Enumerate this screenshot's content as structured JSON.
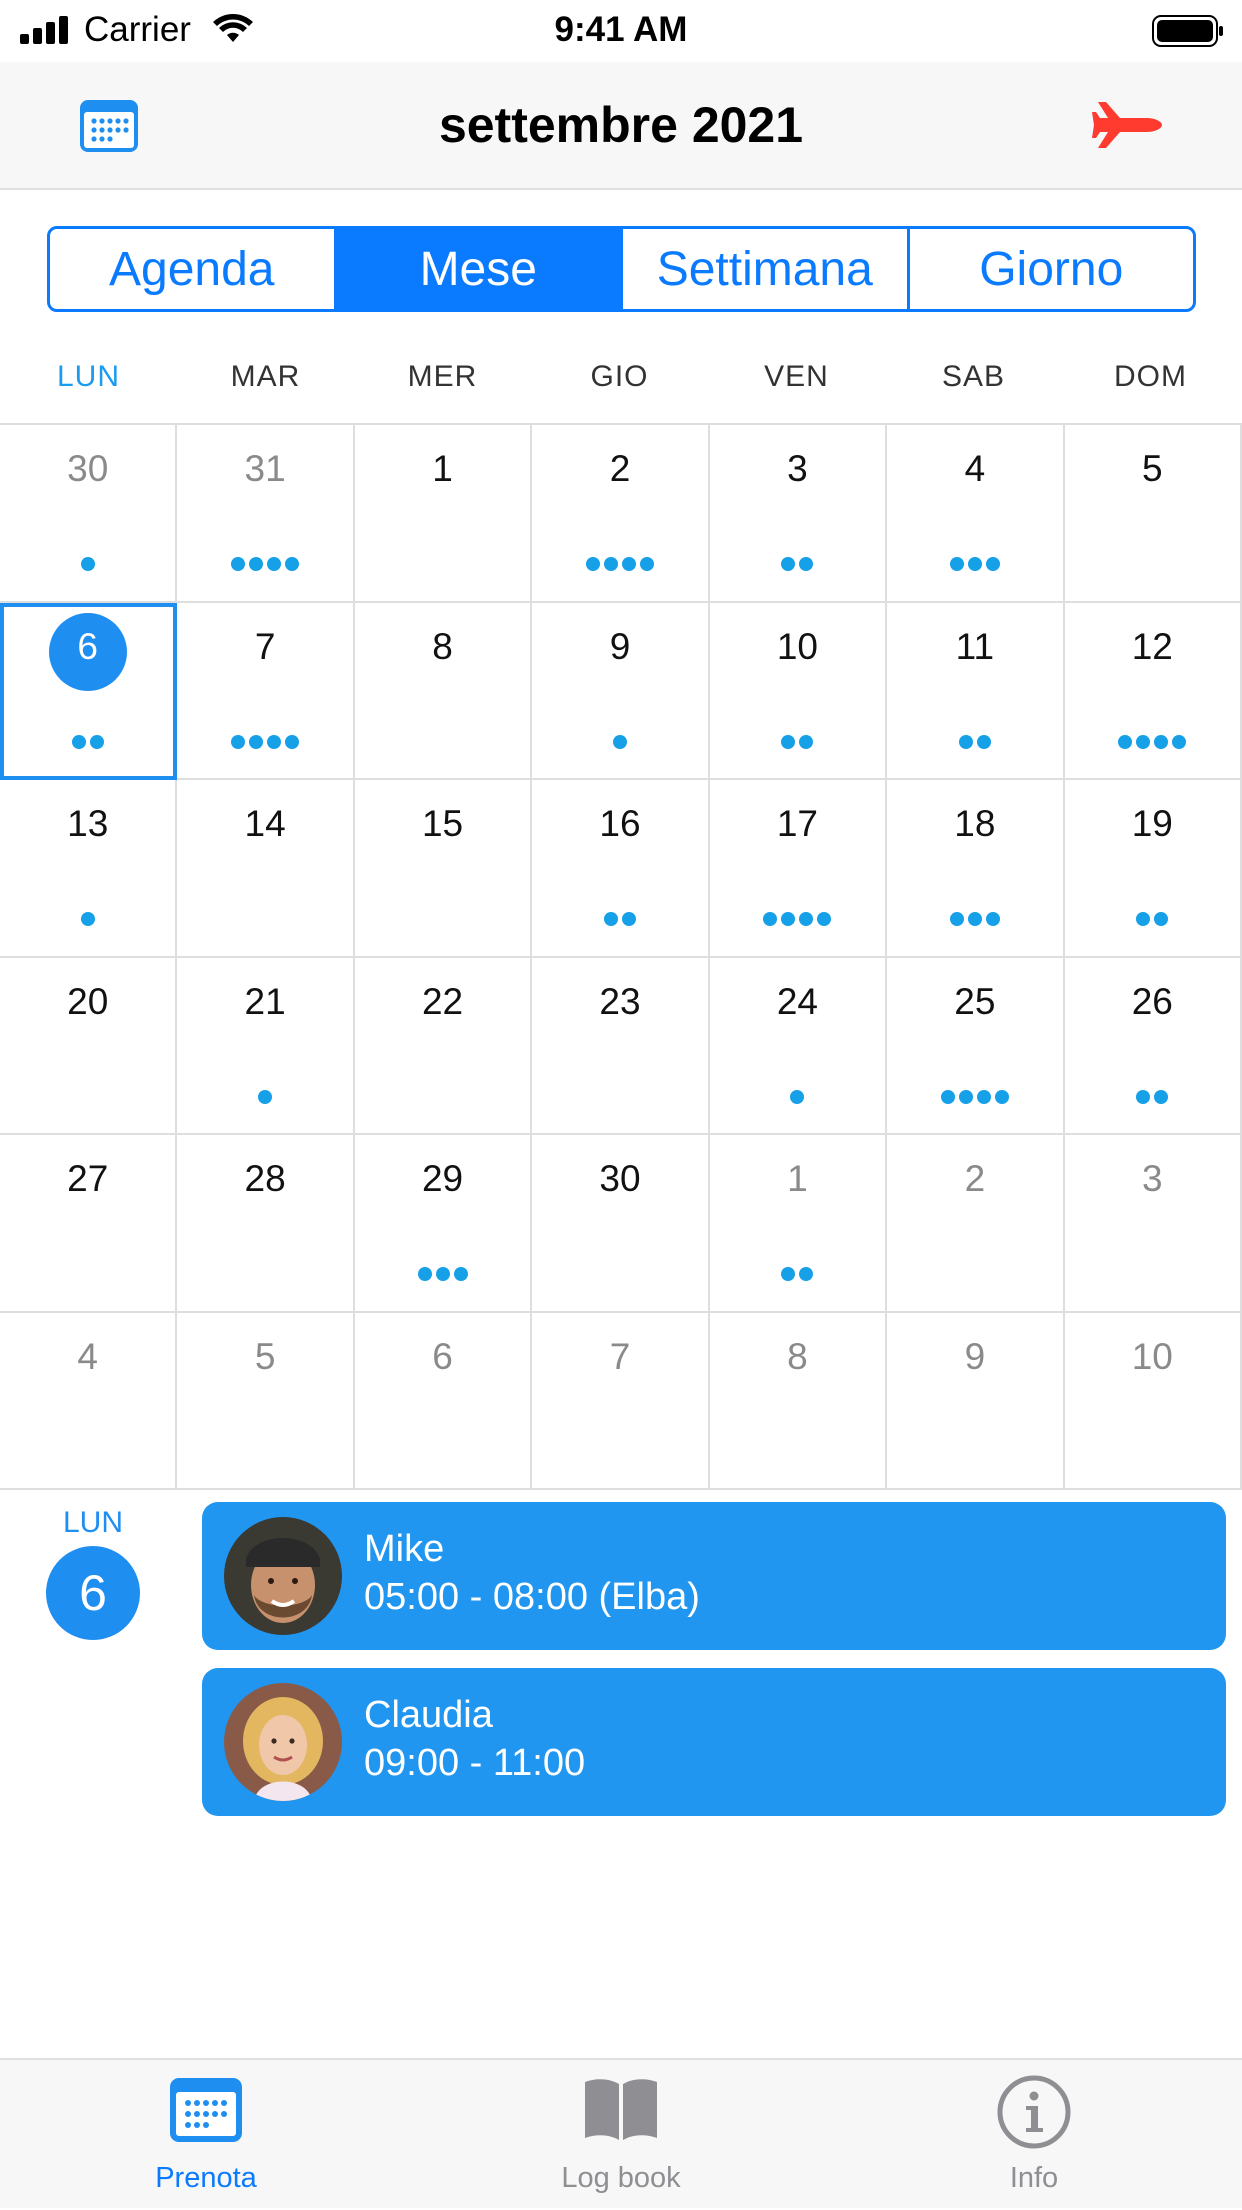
{
  "status_bar": {
    "carrier": "Carrier",
    "time": "9:41 AM"
  },
  "nav": {
    "title": "settembre 2021",
    "left_icon": "calendar-icon",
    "right_icon": "airplane-icon",
    "accent": "#0a7aff",
    "right_icon_color": "#ff3b30"
  },
  "segments": [
    {
      "label": "Agenda",
      "active": false
    },
    {
      "label": "Mese",
      "active": true
    },
    {
      "label": "Settimana",
      "active": false
    },
    {
      "label": "Giorno",
      "active": false
    }
  ],
  "weekdays": [
    "LUN",
    "MAR",
    "MER",
    "GIO",
    "VEN",
    "SAB",
    "DOM"
  ],
  "calendar": {
    "selected_day": "6",
    "weeks": [
      [
        {
          "day": "30",
          "other": true,
          "dots": 1
        },
        {
          "day": "31",
          "other": true,
          "dots": 4
        },
        {
          "day": "1",
          "dots": 0
        },
        {
          "day": "2",
          "dots": 4
        },
        {
          "day": "3",
          "dots": 2
        },
        {
          "day": "4",
          "dots": 3
        },
        {
          "day": "5",
          "dots": 0
        }
      ],
      [
        {
          "day": "6",
          "dots": 2,
          "selected": true
        },
        {
          "day": "7",
          "dots": 4
        },
        {
          "day": "8",
          "dots": 0
        },
        {
          "day": "9",
          "dots": 1
        },
        {
          "day": "10",
          "dots": 2
        },
        {
          "day": "11",
          "dots": 2
        },
        {
          "day": "12",
          "dots": 4
        }
      ],
      [
        {
          "day": "13",
          "dots": 1
        },
        {
          "day": "14",
          "dots": 0
        },
        {
          "day": "15",
          "dots": 0
        },
        {
          "day": "16",
          "dots": 2
        },
        {
          "day": "17",
          "dots": 4
        },
        {
          "day": "18",
          "dots": 3
        },
        {
          "day": "19",
          "dots": 2
        }
      ],
      [
        {
          "day": "20",
          "dots": 0
        },
        {
          "day": "21",
          "dots": 1
        },
        {
          "day": "22",
          "dots": 0
        },
        {
          "day": "23",
          "dots": 0
        },
        {
          "day": "24",
          "dots": 1
        },
        {
          "day": "25",
          "dots": 4
        },
        {
          "day": "26",
          "dots": 2
        }
      ],
      [
        {
          "day": "27",
          "dots": 0
        },
        {
          "day": "28",
          "dots": 0
        },
        {
          "day": "29",
          "dots": 3
        },
        {
          "day": "30",
          "dots": 0
        },
        {
          "day": "1",
          "other": true,
          "dots": 2
        },
        {
          "day": "2",
          "other": true,
          "dots": 0
        },
        {
          "day": "3",
          "other": true,
          "dots": 0
        }
      ],
      [
        {
          "day": "4",
          "other": true,
          "dots": 0
        },
        {
          "day": "5",
          "other": true,
          "dots": 0
        },
        {
          "day": "6",
          "other": true,
          "dots": 0
        },
        {
          "day": "7",
          "other": true,
          "dots": 0
        },
        {
          "day": "8",
          "other": true,
          "dots": 0
        },
        {
          "day": "9",
          "other": true,
          "dots": 0
        },
        {
          "day": "10",
          "other": true,
          "dots": 0
        }
      ]
    ]
  },
  "selected_date": {
    "weekday": "LUN",
    "day": "6"
  },
  "events": [
    {
      "name": "Mike",
      "time": "05:00 - 08:00 (Elba)",
      "avatar": "avatar-mike"
    },
    {
      "name": "Claudia",
      "time": "09:00 - 11:00",
      "avatar": "avatar-claudia"
    }
  ],
  "tabs": [
    {
      "label": "Prenota",
      "icon": "calendar-icon",
      "active": true
    },
    {
      "label": "Log book",
      "icon": "book-icon",
      "active": false
    },
    {
      "label": "Info",
      "icon": "info-icon",
      "active": false
    }
  ]
}
